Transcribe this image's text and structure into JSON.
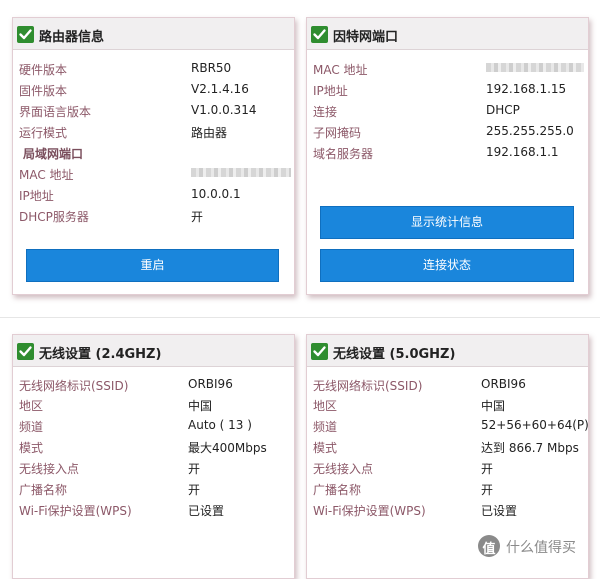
{
  "router_info": {
    "title": "路由器信息",
    "rows": [
      {
        "label": "硬件版本",
        "value": "RBR50"
      },
      {
        "label": "固件版本",
        "value": "V2.1.4.16"
      },
      {
        "label": "界面语言版本",
        "value": "V1.0.0.314"
      },
      {
        "label": "运行模式",
        "value": "路由器"
      }
    ],
    "lan_header": "局域网端口",
    "lan_rows": [
      {
        "label": "MAC 地址",
        "value": ""
      },
      {
        "label": "IP地址",
        "value": "10.0.0.1"
      },
      {
        "label": "DHCP服务器",
        "value": "开"
      }
    ],
    "reboot_label": "重启"
  },
  "internet_port": {
    "title": "因特网端口",
    "rows": [
      {
        "label": "MAC 地址",
        "value": ""
      },
      {
        "label": "IP地址",
        "value": "192.168.1.15"
      },
      {
        "label": "连接",
        "value": "DHCP"
      },
      {
        "label": "子网掩码",
        "value": "255.255.255.0"
      },
      {
        "label": "域名服务器",
        "value": "192.168.1.1"
      }
    ],
    "stats_label": "显示统计信息",
    "status_label": "连接状态"
  },
  "wireless_24": {
    "title": "无线设置 (2.4GHZ)",
    "rows": [
      {
        "label": "无线网络标识(SSID)",
        "value": "ORBI96"
      },
      {
        "label": "地区",
        "value": "中国"
      },
      {
        "label": "频道",
        "value": "Auto ( 13 )"
      },
      {
        "label": "模式",
        "value": "最大400Mbps"
      },
      {
        "label": "无线接入点",
        "value": "开"
      },
      {
        "label": "广播名称",
        "value": "开"
      },
      {
        "label": "Wi-Fi保护设置(WPS)",
        "value": "已设置"
      }
    ]
  },
  "wireless_50": {
    "title": "无线设置 (5.0GHZ)",
    "rows": [
      {
        "label": "无线网络标识(SSID)",
        "value": "ORBI96"
      },
      {
        "label": "地区",
        "value": "中国"
      },
      {
        "label": "频道",
        "value": "52+56+60+64(P)"
      },
      {
        "label": "模式",
        "value": "达到 866.7 Mbps"
      },
      {
        "label": "无线接入点",
        "value": "开"
      },
      {
        "label": "广播名称",
        "value": "开"
      },
      {
        "label": "Wi-Fi保护设置(WPS)",
        "value": "已设置"
      }
    ]
  },
  "watermark": {
    "icon_glyph": "值",
    "text": "什么值得买"
  },
  "colors": {
    "label": "#8c5868",
    "button": "#1a86dc",
    "check": "#2f8d2f",
    "header": "#f1eff0"
  }
}
